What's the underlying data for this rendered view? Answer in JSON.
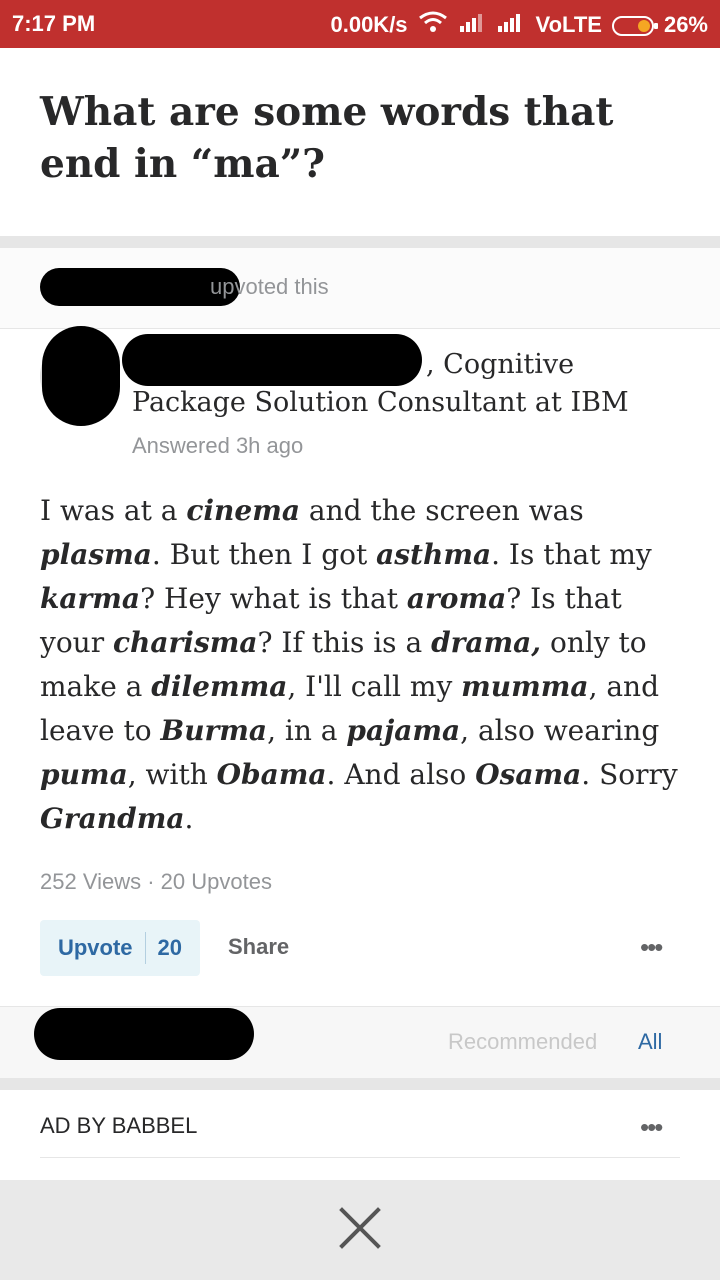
{
  "status_bar": {
    "time": "7:17 PM",
    "speed": "0.00K/s",
    "network": "VoLTE",
    "battery": "26%",
    "color": "#c0302e"
  },
  "question": {
    "title": "What are some words that end in “ma”?"
  },
  "activity": {
    "text": "upvoted this"
  },
  "author": {
    "credential_line1": ", Cognitive",
    "credential_line2": "Package Solution Consultant at IBM",
    "answered": "Answered 3h ago"
  },
  "answer": {
    "segments": [
      {
        "t": "I was at a ",
        "b": false
      },
      {
        "t": "cinema",
        "b": true
      },
      {
        "t": " and the screen was ",
        "b": false
      },
      {
        "t": "plasma",
        "b": true
      },
      {
        "t": ". But then I got ",
        "b": false
      },
      {
        "t": "asthma",
        "b": true
      },
      {
        "t": ". Is that my ",
        "b": false
      },
      {
        "t": "karma",
        "b": true
      },
      {
        "t": "? Hey what is that ",
        "b": false
      },
      {
        "t": "aroma",
        "b": true
      },
      {
        "t": "? Is that your ",
        "b": false
      },
      {
        "t": "charisma",
        "b": true
      },
      {
        "t": "? If this is a ",
        "b": false
      },
      {
        "t": "drama,",
        "b": true
      },
      {
        "t": " only to make a ",
        "b": false
      },
      {
        "t": "dilemma",
        "b": true
      },
      {
        "t": ", I'll call my ",
        "b": false
      },
      {
        "t": "mumma",
        "b": true
      },
      {
        "t": ", and leave to ",
        "b": false
      },
      {
        "t": "Burma",
        "b": true
      },
      {
        "t": ", in a ",
        "b": false
      },
      {
        "t": "pajama",
        "b": true
      },
      {
        "t": ", also wearing ",
        "b": false
      },
      {
        "t": "puma",
        "b": true
      },
      {
        "t": ", with ",
        "b": false
      },
      {
        "t": "Obama",
        "b": true
      },
      {
        "t": ". And also ",
        "b": false
      },
      {
        "t": "Osama",
        "b": true
      },
      {
        "t": ". Sorry ",
        "b": false
      },
      {
        "t": "Grandma",
        "b": true
      },
      {
        "t": ".",
        "b": false
      }
    ]
  },
  "stats": {
    "text": "252 Views · 20 Upvotes"
  },
  "actions": {
    "upvote_label": "Upvote",
    "upvote_count": "20",
    "share_label": "Share",
    "more": "•••"
  },
  "comments": {
    "recommended": "Recommended",
    "all": "All"
  },
  "ad": {
    "label": "AD BY BABBEL",
    "more": "•••"
  },
  "colors": {
    "link_blue": "#2e69a3",
    "upvote_bg": "#e8f4f8",
    "muted_text": "#939598"
  }
}
